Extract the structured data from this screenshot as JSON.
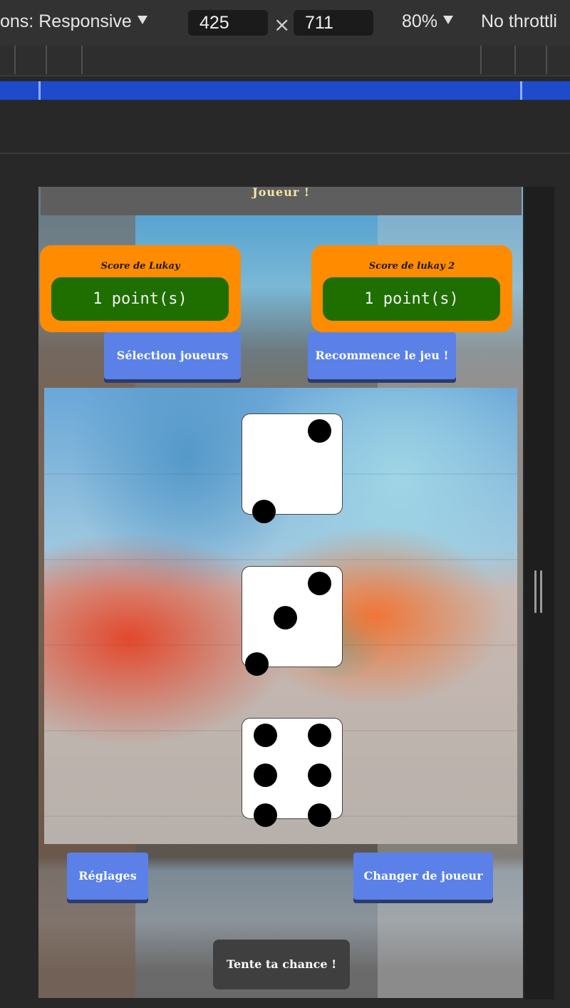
{
  "devtools": {
    "dimensions_label": "ons: Responsive",
    "width_value": "425",
    "times": "×",
    "height_value": "711",
    "zoom": "80%",
    "throttle": "No throttli"
  },
  "page": {
    "banner_text": "Joueur !",
    "player1": {
      "title": "Score de Lukay",
      "points": "1 point(s)"
    },
    "player2": {
      "title": "Score de lukay 2",
      "points": "1 point(s)"
    },
    "select_players_button": "Sélection joueurs",
    "restart_button": "Recommence le jeu !",
    "settings_button": "Réglages",
    "change_player_button": "Changer de joueur",
    "try_luck_button": "Tente ta chance !",
    "dice": [
      2,
      3,
      6
    ]
  }
}
